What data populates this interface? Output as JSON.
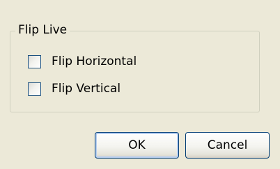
{
  "group": {
    "title": "Flip Live"
  },
  "options": [
    {
      "label": "Flip Horizontal",
      "checked": false
    },
    {
      "label": "Flip Vertical",
      "checked": false
    }
  ],
  "buttons": {
    "ok_label": "OK",
    "cancel_label": "Cancel"
  },
  "colors": {
    "dialog_bg": "#ece9d8",
    "group_border": "#d0d0bf",
    "checkbox_border": "#1c5180",
    "button_border": "#003c74"
  }
}
